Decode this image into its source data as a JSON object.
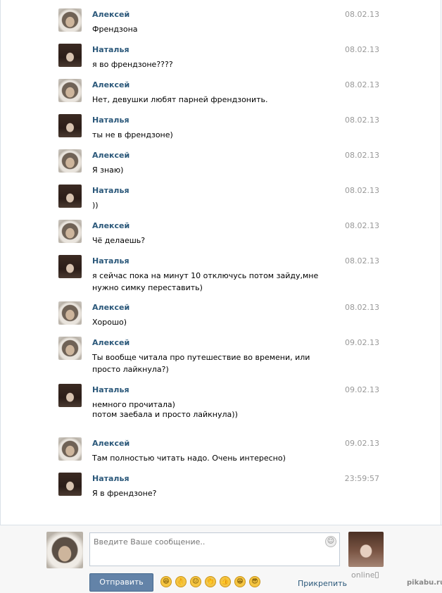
{
  "messages": [
    {
      "author": "Алексей",
      "time": "08.02.13",
      "text": "Френдзона",
      "avatar": "male"
    },
    {
      "author": "Наталья",
      "time": "08.02.13",
      "text": "я во френдзоне????",
      "avatar": "female"
    },
    {
      "author": "Алексей",
      "time": "08.02.13",
      "text": "Нет, девушки любят парней френдзонить.",
      "avatar": "male"
    },
    {
      "author": "Наталья",
      "time": "08.02.13",
      "text": "ты не в френдзоне)",
      "avatar": "female"
    },
    {
      "author": "Алексей",
      "time": "08.02.13",
      "text": "Я знаю)",
      "avatar": "male"
    },
    {
      "author": "Наталья",
      "time": "08.02.13",
      "text": "))",
      "avatar": "female"
    },
    {
      "author": "Алексей",
      "time": "08.02.13",
      "text": "Чё делаешь?",
      "avatar": "male"
    },
    {
      "author": "Наталья",
      "time": "08.02.13",
      "text": "я сейчас пока на минут  10 отключусь потом зайду,мне нужно симку переставить)",
      "avatar": "female"
    },
    {
      "author": "Алексей",
      "time": "08.02.13",
      "text": "Хорошо)",
      "avatar": "male"
    },
    {
      "author": "Алексей",
      "time": "09.02.13",
      "text": "Ты вообще читала про путешествие во времени, или просто лайкнула?)",
      "avatar": "male"
    },
    {
      "author": "Наталья",
      "time": "09.02.13",
      "text": "немного прочитала)",
      "avatar": "female"
    },
    {
      "author": "",
      "time": "",
      "text": "потом заебала и просто лайкнула))",
      "avatar": ""
    },
    {
      "author": "Алексей",
      "time": "09.02.13",
      "text": "Там полностью читать надо. Очень интересно)",
      "avatar": "male"
    },
    {
      "author": "Наталья",
      "time": "23:59:57",
      "text": "Я в френдзоне?",
      "avatar": "female"
    }
  ],
  "composer": {
    "placeholder": "Введите Ваше сообщение..",
    "send_label": "Отправить",
    "attach_label": "Прикрепить",
    "status": "online",
    "emojis": [
      "😆",
      "👌",
      "😐",
      "👏",
      "👍",
      "😁",
      "😎"
    ]
  },
  "watermark": "pikabu.ru",
  "colors": {
    "author": "#2b587a",
    "button": "#6383a8",
    "time": "#999999"
  }
}
